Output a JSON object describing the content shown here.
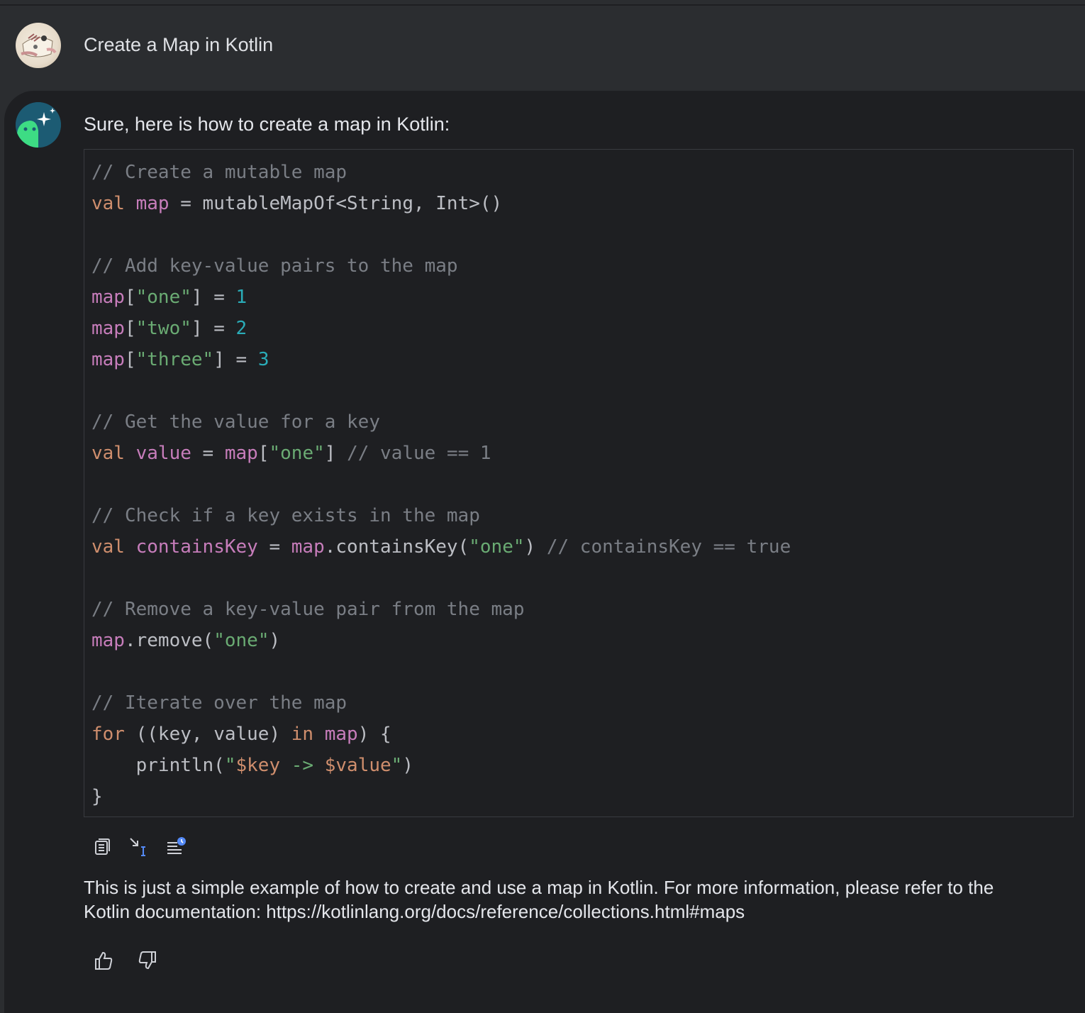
{
  "user_message": {
    "title": "Create a Map in Kotlin"
  },
  "assistant_message": {
    "intro": "Sure, here is how to create a map in Kotlin:",
    "outro_line1": "This is just a simple example of how to create and use a map in Kotlin. For more information, please refer to the",
    "outro_line2": "Kotlin documentation: https://kotlinlang.org/docs/reference/collections.html#maps",
    "code": {
      "language": "kotlin",
      "lines": [
        [
          {
            "t": "// Create a mutable map",
            "c": "comment"
          }
        ],
        [
          {
            "t": "val ",
            "c": "kw"
          },
          {
            "t": "map",
            "c": "var"
          },
          {
            "t": " = mutableMapOf<String, Int>()",
            "c": "plain"
          }
        ],
        [],
        [
          {
            "t": "// Add key-value pairs to the map",
            "c": "comment"
          }
        ],
        [
          {
            "t": "map",
            "c": "var"
          },
          {
            "t": "[",
            "c": "plain"
          },
          {
            "t": "\"one\"",
            "c": "str"
          },
          {
            "t": "] = ",
            "c": "plain"
          },
          {
            "t": "1",
            "c": "num"
          }
        ],
        [
          {
            "t": "map",
            "c": "var"
          },
          {
            "t": "[",
            "c": "plain"
          },
          {
            "t": "\"two\"",
            "c": "str"
          },
          {
            "t": "] = ",
            "c": "plain"
          },
          {
            "t": "2",
            "c": "num"
          }
        ],
        [
          {
            "t": "map",
            "c": "var"
          },
          {
            "t": "[",
            "c": "plain"
          },
          {
            "t": "\"three\"",
            "c": "str"
          },
          {
            "t": "] = ",
            "c": "plain"
          },
          {
            "t": "3",
            "c": "num"
          }
        ],
        [],
        [
          {
            "t": "// Get the value for a key",
            "c": "comment"
          }
        ],
        [
          {
            "t": "val ",
            "c": "kw"
          },
          {
            "t": "value",
            "c": "var"
          },
          {
            "t": " = ",
            "c": "plain"
          },
          {
            "t": "map",
            "c": "var"
          },
          {
            "t": "[",
            "c": "plain"
          },
          {
            "t": "\"one\"",
            "c": "str"
          },
          {
            "t": "] ",
            "c": "plain"
          },
          {
            "t": "// value == 1",
            "c": "comment"
          }
        ],
        [],
        [
          {
            "t": "// Check if a key exists in the map",
            "c": "comment"
          }
        ],
        [
          {
            "t": "val ",
            "c": "kw"
          },
          {
            "t": "containsKey",
            "c": "var"
          },
          {
            "t": " = ",
            "c": "plain"
          },
          {
            "t": "map",
            "c": "var"
          },
          {
            "t": ".containsKey(",
            "c": "plain"
          },
          {
            "t": "\"one\"",
            "c": "str"
          },
          {
            "t": ") ",
            "c": "plain"
          },
          {
            "t": "// containsKey == true",
            "c": "comment"
          }
        ],
        [],
        [
          {
            "t": "// Remove a key-value pair from the map",
            "c": "comment"
          }
        ],
        [
          {
            "t": "map",
            "c": "var"
          },
          {
            "t": ".remove(",
            "c": "plain"
          },
          {
            "t": "\"one\"",
            "c": "str"
          },
          {
            "t": ")",
            "c": "plain"
          }
        ],
        [],
        [
          {
            "t": "// Iterate over the map",
            "c": "comment"
          }
        ],
        [
          {
            "t": "for ",
            "c": "kw"
          },
          {
            "t": "((key, value) ",
            "c": "plain"
          },
          {
            "t": "in ",
            "c": "kw"
          },
          {
            "t": "map",
            "c": "var"
          },
          {
            "t": ") {",
            "c": "plain"
          }
        ],
        [
          {
            "t": "    println(",
            "c": "plain"
          },
          {
            "t": "\"",
            "c": "str"
          },
          {
            "t": "$key",
            "c": "kw"
          },
          {
            "t": " -> ",
            "c": "str"
          },
          {
            "t": "$value",
            "c": "kw"
          },
          {
            "t": "\"",
            "c": "str"
          },
          {
            "t": ")",
            "c": "plain"
          }
        ],
        [
          {
            "t": "}",
            "c": "plain"
          }
        ]
      ]
    },
    "code_toolbar": {
      "icons": [
        "copy-icon",
        "insert-at-caret-icon",
        "explain-icon"
      ]
    },
    "feedback": {
      "icons": [
        "thumbs-up-icon",
        "thumbs-down-icon"
      ]
    }
  },
  "colors": {
    "background": "#2b2d30",
    "card": "#1e1f22",
    "comment": "#7a7e85",
    "keyword": "#cf8e6d",
    "variable": "#c77dbb",
    "string": "#6aab73",
    "number": "#2aacb8",
    "accent": "#548af7"
  }
}
